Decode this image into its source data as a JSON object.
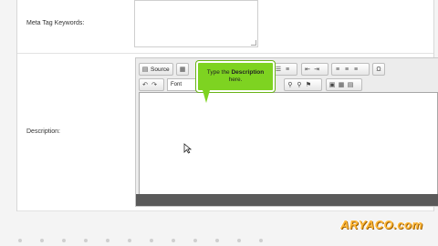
{
  "form": {
    "meta_keywords_label": "Meta Tag Keywords:",
    "description_label": "Description:"
  },
  "editor": {
    "source_label": "Source",
    "font_label": "Font",
    "icons": [
      "source-icon",
      "save-template-icon",
      "bullet-list-icon",
      "numbered-list-icon",
      "outdent-icon",
      "indent-icon",
      "align-left-icon",
      "align-center-icon",
      "align-right-icon",
      "omega-special-char-icon",
      "undo-icon",
      "redo-icon",
      "find-icon",
      "replace-icon",
      "anchor-icon",
      "image-icon",
      "table-icon",
      "horizontal-rule-icon"
    ]
  },
  "tooltip": {
    "prefix": "Type the ",
    "bold": "Description",
    "suffix": "here."
  },
  "watermark": "ARYACO.com"
}
